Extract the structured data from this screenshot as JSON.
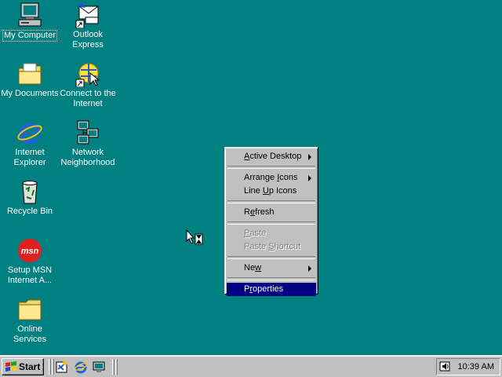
{
  "desktop": {
    "background": "#008080",
    "icons": [
      {
        "label": "My Computer",
        "icon": "my-computer-icon"
      },
      {
        "label": "Outlook Express",
        "icon": "outlook-express-icon"
      },
      {
        "label": "My Documents",
        "icon": "my-documents-icon"
      },
      {
        "label": "Connect to the Internet",
        "icon": "connect-internet-icon"
      },
      {
        "label": "Internet Explorer",
        "icon": "internet-explorer-icon"
      },
      {
        "label": "Network Neighborhood",
        "icon": "network-neighborhood-icon"
      },
      {
        "label": "Recycle Bin",
        "icon": "recycle-bin-icon"
      },
      {
        "label": "Setup MSN Internet A...",
        "icon": "msn-setup-icon"
      },
      {
        "label": "Online Services",
        "icon": "online-services-folder-icon"
      }
    ]
  },
  "context_menu": {
    "items": [
      {
        "pre": "",
        "ul": "A",
        "post": "ctive Desktop",
        "submenu": true
      },
      {
        "pre": "Arrange ",
        "ul": "I",
        "post": "cons",
        "submenu": true
      },
      {
        "pre": "Line ",
        "ul": "U",
        "post": "p Icons"
      },
      {
        "pre": "R",
        "ul": "e",
        "post": "fresh"
      },
      {
        "pre": "",
        "ul": "P",
        "post": "aste",
        "disabled": true
      },
      {
        "pre": "Paste ",
        "ul": "S",
        "post": "hortcut",
        "disabled": true
      },
      {
        "pre": "Ne",
        "ul": "w",
        "post": "",
        "submenu": true
      },
      {
        "pre": "P",
        "ul": "r",
        "post": "operties",
        "highlighted": true
      }
    ]
  },
  "taskbar": {
    "start_label": "Start",
    "quick_launch": [
      "launch-channels-icon",
      "internet-explorer-icon",
      "show-desktop-icon"
    ],
    "clock": "10:39 AM",
    "tray_icons": [
      "volume-icon"
    ]
  },
  "colors": {
    "menu_highlight": "#000080",
    "face": "#c0c0c0"
  }
}
